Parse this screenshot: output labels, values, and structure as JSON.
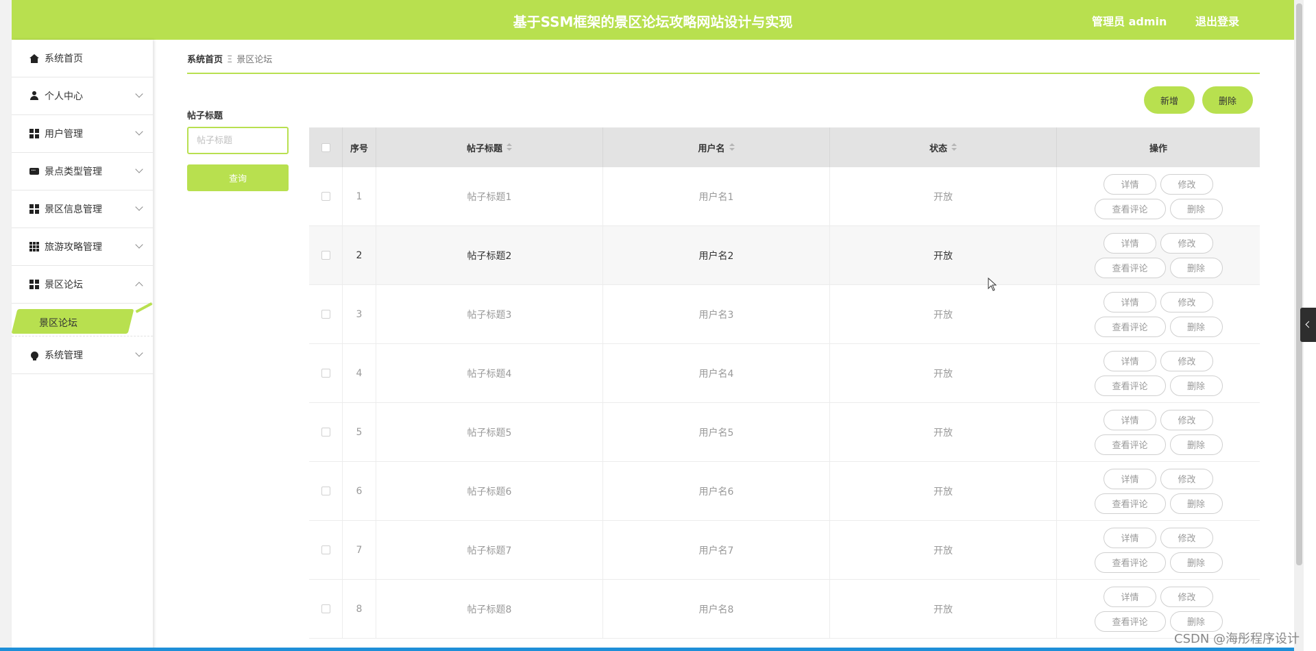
{
  "header": {
    "title": "基于SSM框架的景区论坛攻略网站设计与实现",
    "user": "管理员 admin",
    "logout": "退出登录"
  },
  "sidebar": {
    "items": [
      {
        "label": "系统首页",
        "icon": "home-icon"
      },
      {
        "label": "个人中心",
        "icon": "user-icon"
      },
      {
        "label": "用户管理",
        "icon": "grid-icon"
      },
      {
        "label": "景点类型管理",
        "icon": "chat-icon"
      },
      {
        "label": "景区信息管理",
        "icon": "grid-icon"
      },
      {
        "label": "旅游攻略管理",
        "icon": "grid9-icon"
      },
      {
        "label": "景区论坛",
        "icon": "grid-icon"
      },
      {
        "label": "系统管理",
        "icon": "bulb-icon"
      }
    ],
    "sub_item": "景区论坛"
  },
  "breadcrumb": {
    "home": "系统首页",
    "sep": "Ξ",
    "current": "景区论坛"
  },
  "search": {
    "label": "帖子标题",
    "placeholder": "帖子标题",
    "button": "查询"
  },
  "actions": {
    "add": "新增",
    "delete": "删除"
  },
  "table": {
    "headers": {
      "index": "序号",
      "title": "帖子标题",
      "user": "用户名",
      "status": "状态",
      "ops": "操作"
    },
    "ops": {
      "detail": "详情",
      "edit": "修改",
      "comments": "查看评论",
      "delete": "删除"
    },
    "rows": [
      {
        "index": "1",
        "title": "帖子标题1",
        "user": "用户名1",
        "status": "开放"
      },
      {
        "index": "2",
        "title": "帖子标题2",
        "user": "用户名2",
        "status": "开放"
      },
      {
        "index": "3",
        "title": "帖子标题3",
        "user": "用户名3",
        "status": "开放"
      },
      {
        "index": "4",
        "title": "帖子标题4",
        "user": "用户名4",
        "status": "开放"
      },
      {
        "index": "5",
        "title": "帖子标题5",
        "user": "用户名5",
        "status": "开放"
      },
      {
        "index": "6",
        "title": "帖子标题6",
        "user": "用户名6",
        "status": "开放"
      },
      {
        "index": "7",
        "title": "帖子标题7",
        "user": "用户名7",
        "status": "开放"
      },
      {
        "index": "8",
        "title": "帖子标题8",
        "user": "用户名8",
        "status": "开放"
      }
    ]
  },
  "watermark": "CSDN @海彤程序设计",
  "colors": {
    "accent": "#b8e04f",
    "header_bg": "#b8e04f",
    "table_header_bg": "#e3e3e3",
    "highlight_row_bg": "#f7f7f7"
  }
}
